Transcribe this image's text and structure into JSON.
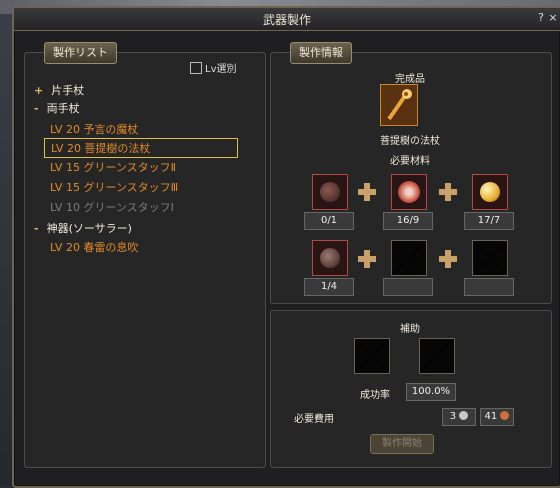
{
  "window": {
    "title": "武器製作",
    "help_label": "?",
    "close_label": "×"
  },
  "left": {
    "tab_label": "製作リスト",
    "lv_filter_label": "Lv選別",
    "categories": [
      {
        "label": "片手杖",
        "expander": "+"
      },
      {
        "label": "両手杖",
        "expander": "-"
      },
      {
        "label": "神器(ソーサラー)",
        "expander": "-"
      }
    ],
    "items": [
      {
        "label": "LV 20 予言の魔杖"
      },
      {
        "label": "LV 20 菩提樹の法杖"
      },
      {
        "label": "LV 15 グリーンスタッフⅡ"
      },
      {
        "label": "LV 15 グリーンスタッフⅢ"
      },
      {
        "label": "LV 10 グリーンスタッフⅠ"
      },
      {
        "label": "LV 20 春雷の息吹"
      }
    ]
  },
  "right": {
    "tab_label": "製作情報",
    "product_heading": "完成品",
    "product_name": "菩提樹の法杖",
    "materials_heading": "必要材料",
    "materials": [
      "0/1",
      "16/9",
      "17/7",
      "1/4",
      "",
      ""
    ],
    "assist_heading": "補助",
    "success_label": "成功率",
    "success_value": "100.0%",
    "cost_label": "必要費用",
    "cost_silver": "3",
    "cost_copper": "41",
    "start_button": "製作開始"
  }
}
